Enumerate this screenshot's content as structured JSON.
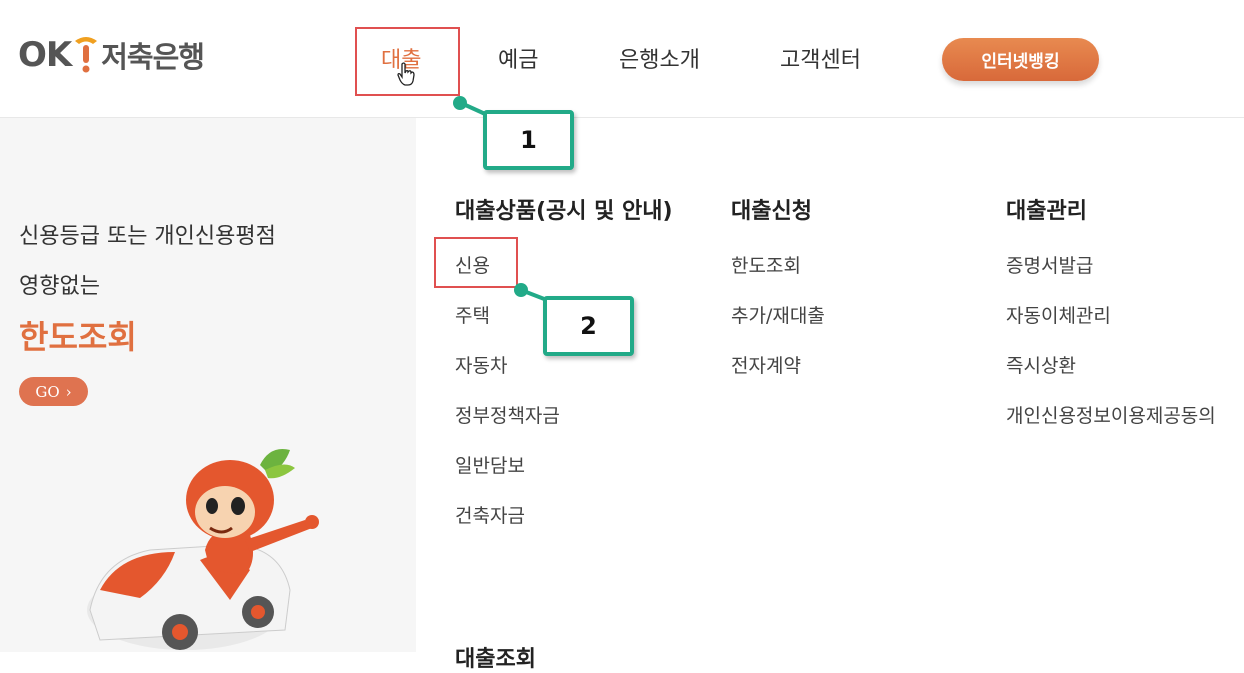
{
  "header": {
    "logo_ok": "OK",
    "logo_bank": "저축은행",
    "nav": [
      "대출",
      "예금",
      "은행소개",
      "고객센터"
    ],
    "internet_banking": "인터넷뱅킹"
  },
  "promo": {
    "line1": "신용등급 또는 개인신용평점",
    "line2": "영향없는",
    "title": "한도조회",
    "go_label": "GO",
    "go_arrow": "›"
  },
  "menu": {
    "columns": [
      {
        "heading": "대출상품(공시 및 안내)",
        "items": [
          "신용",
          "주택",
          "자동차",
          "정부정책자금",
          "일반담보",
          "건축자금"
        ]
      },
      {
        "heading": "대출신청",
        "items": [
          "한도조회",
          "추가/재대출",
          "전자계약"
        ]
      },
      {
        "heading": "대출관리",
        "items": [
          "증명서발급",
          "자동이체관리",
          "즉시상환",
          "개인신용정보이용제공동의"
        ]
      }
    ],
    "cut_heading": "대출조회"
  },
  "annotations": {
    "callout_1": "1",
    "callout_2": "2"
  },
  "colors": {
    "brand_orange": "#e07040",
    "highlight_red": "#e05050",
    "callout_green": "#22aa88"
  }
}
